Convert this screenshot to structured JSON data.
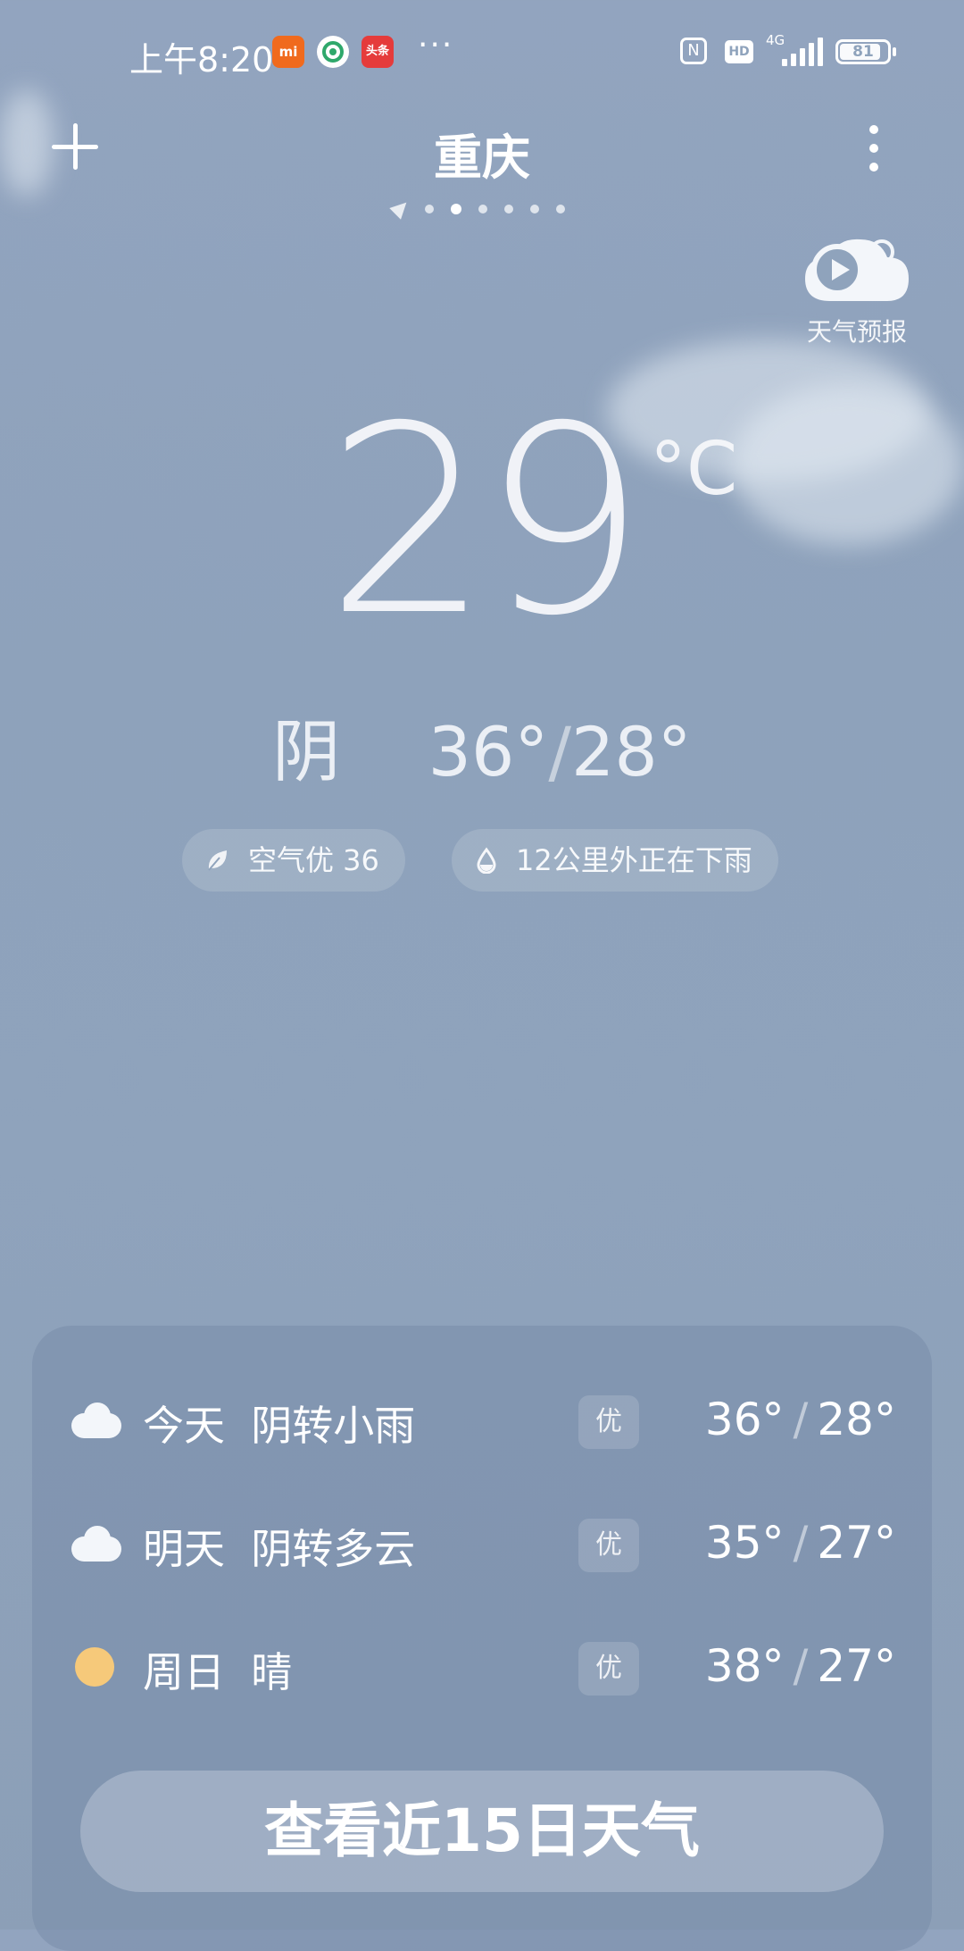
{
  "status_bar": {
    "time": "上午8:20",
    "network": "4G",
    "battery": "81",
    "more": "···",
    "apps": [
      {
        "name": "mi-app-icon",
        "label": "mi",
        "color": "#f06a1d"
      },
      {
        "name": "china-mobile-icon",
        "label": "",
        "color": "#ffffff"
      },
      {
        "name": "toutiao-icon",
        "label": "头条",
        "color": "#e53b3b"
      }
    ]
  },
  "header": {
    "city": "重庆",
    "video_label": "天气预报"
  },
  "current": {
    "temperature": "29",
    "unit": "°C",
    "condition": "阴",
    "high": "36°",
    "low": "28°",
    "separator": "/"
  },
  "pills": {
    "air": "空气优 36",
    "rain": "12公里外正在下雨"
  },
  "forecast": [
    {
      "day": "今天",
      "weather": "阴转小雨",
      "aqi": "优",
      "high": "36°",
      "low": "28°",
      "icon": "cloud"
    },
    {
      "day": "明天",
      "weather": "阴转多云",
      "aqi": "优",
      "high": "35°",
      "low": "27°",
      "icon": "cloud"
    },
    {
      "day": "周日",
      "weather": "晴",
      "aqi": "优",
      "high": "38°",
      "low": "27°",
      "icon": "sun"
    }
  ],
  "button_15day": "查看近15日天气"
}
